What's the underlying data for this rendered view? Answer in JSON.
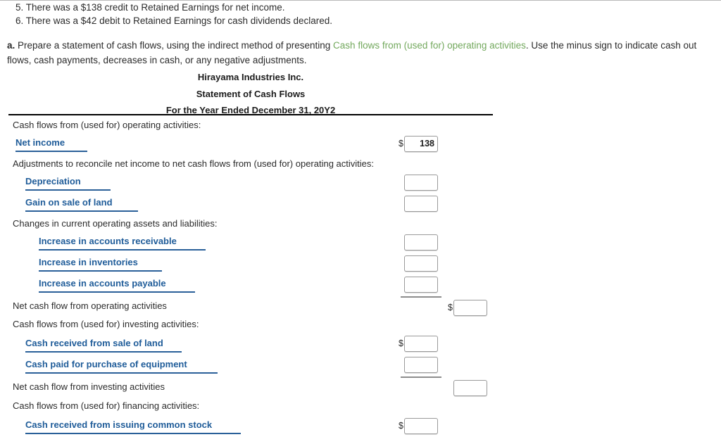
{
  "intro": {
    "items": [
      "5. There was a $138 credit to Retained Earnings for net income.",
      "6. There was a $42 debit to Retained Earnings for cash dividends declared."
    ],
    "prompt_label": "a.",
    "prompt_part1": "Prepare a statement of cash flows, using the indirect method of presenting",
    "prompt_link": "Cash flows from (used for) operating activities",
    "prompt_part2": ". Use the minus sign to indicate cash out flows, cash payments, decreases in cash, or any negative adjustments."
  },
  "statement": {
    "company": "Hirayama Industries Inc.",
    "title": "Statement of Cash Flows",
    "period": "For the Year Ended December 31, 20Y2"
  },
  "rows": {
    "operating_header": "Cash flows from (used for) operating activities:",
    "net_income": "Net income",
    "net_income_dollar": "$",
    "net_income_value": "138",
    "adjustments_header": "Adjustments to reconcile net income to net cash flows from (used for) operating activities:",
    "depreciation": "Depreciation",
    "gain_on_sale_of_land": "Gain on sale of land",
    "changes_header": "Changes in current operating assets and liabilities:",
    "increase_ar": "Increase in accounts receivable",
    "increase_inventories": "Increase in inventories",
    "increase_ap": "Increase in accounts payable",
    "net_operating": "Net cash flow from operating activities",
    "net_operating_dollar": "$",
    "investing_header": "Cash flows from (used for) investing activities:",
    "cash_received_sale_land": "Cash received from sale of land",
    "cash_received_sale_land_dollar": "$",
    "cash_paid_equipment": "Cash paid for purchase of equipment",
    "net_investing": "Net cash flow from investing activities",
    "financing_header": "Cash flows from (used for) financing activities:",
    "cash_received_stock": "Cash received from issuing common stock",
    "cash_received_stock_dollar": "$"
  },
  "colors": {
    "link_green": "#72a85c",
    "label_blue": "#1f5c99",
    "underline_blue": "#2a6099",
    "text": "#2b2b2b"
  }
}
